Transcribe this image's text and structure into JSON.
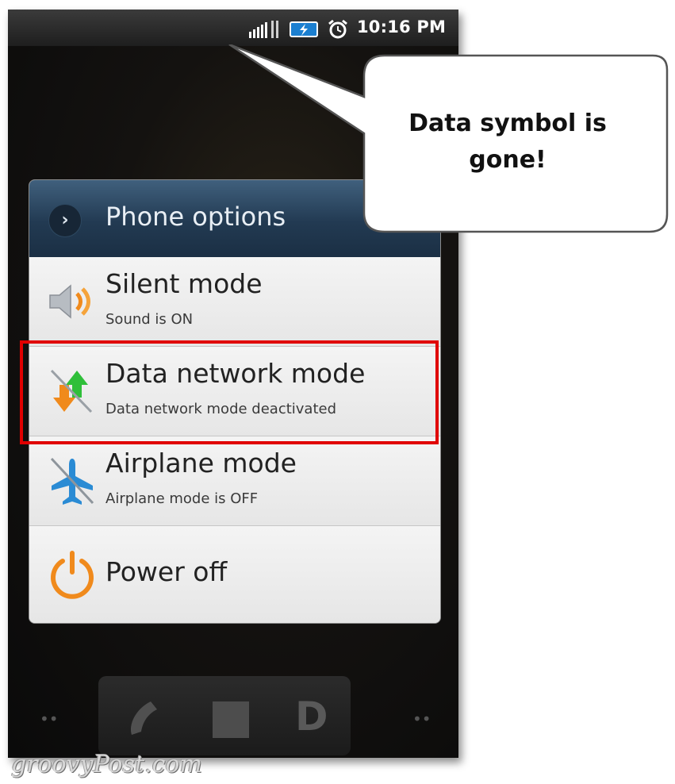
{
  "status_bar": {
    "time": "10:16 PM",
    "icons": [
      "signal-icon",
      "battery-charging-icon",
      "alarm-icon"
    ]
  },
  "dialog": {
    "title": "Phone options",
    "options": [
      {
        "icon": "speaker-icon",
        "title": "Silent mode",
        "subtitle": "Sound is ON"
      },
      {
        "icon": "data-network-icon",
        "title": "Data network mode",
        "subtitle": "Data network mode deactivated"
      },
      {
        "icon": "airplane-icon",
        "title": "Airplane mode",
        "subtitle": "Airplane mode is OFF"
      },
      {
        "icon": "power-icon",
        "title": "Power off",
        "subtitle": ""
      }
    ]
  },
  "callout": {
    "line1": "Data symbol is",
    "line2": "gone!"
  },
  "dock": {
    "icons": [
      "phone-icon",
      "apps-grid-icon",
      "d-icon"
    ],
    "d_label": "D"
  },
  "watermark": "groovyPost.com",
  "colors": {
    "highlight": "#e00000",
    "header": "#223a52",
    "accent_orange": "#f08a1c",
    "accent_green": "#2fbf3a",
    "accent_blue": "#2a8bd4"
  }
}
